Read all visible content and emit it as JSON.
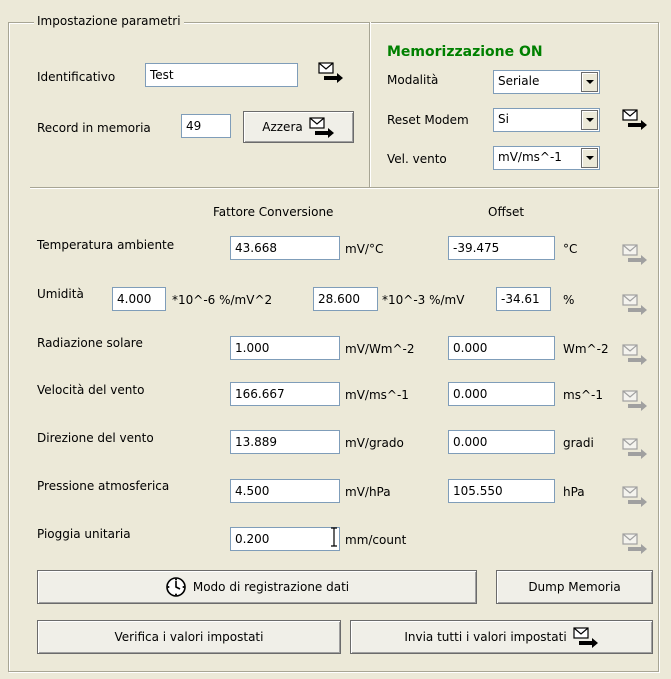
{
  "group": {
    "title": "Impostazione parametri"
  },
  "left_top": {
    "identificativo_label": "Identificativo",
    "identificativo_value": "Test",
    "record_label": "Record in memoria",
    "record_value": "49",
    "azzera_label": "Azzera"
  },
  "memorizzazione": {
    "title": "Memorizzazione ON",
    "modalita_label": "Modalità",
    "modalita_value": "Seriale",
    "reset_label": "Reset Modem",
    "reset_value": "Si",
    "vento_label": "Vel. vento",
    "vento_value": "mV/ms^-1"
  },
  "headers": {
    "fattore": "Fattore Conversione",
    "offset": "Offset"
  },
  "rows": [
    {
      "label": "Temperatura ambiente",
      "factor": "43.668",
      "factor_unit": "mV/°C",
      "offset": "-39.475",
      "offset_unit": "°C"
    },
    {
      "label": "Radiazione solare",
      "factor": "1.000",
      "factor_unit": "mV/Wm^-2",
      "offset": "0.000",
      "offset_unit": "Wm^-2"
    },
    {
      "label": "Velocità del vento",
      "factor": "166.667",
      "factor_unit": "mV/ms^-1",
      "offset": "0.000",
      "offset_unit": "ms^-1"
    },
    {
      "label": "Direzione del vento",
      "factor": "13.889",
      "factor_unit": "mV/grado",
      "offset": "0.000",
      "offset_unit": "gradi"
    },
    {
      "label": "Pressione atmosferica",
      "factor": "4.500",
      "factor_unit": "mV/hPa",
      "offset": "105.550",
      "offset_unit": "hPa"
    },
    {
      "label": "Pioggia unitaria",
      "factor": "0.200",
      "factor_unit": "mm/count"
    }
  ],
  "umidita": {
    "label": "Umidità",
    "v1": "4.000",
    "u1": "*10^-6 %/mV^2",
    "v2": "28.600",
    "u2": "*10^-3 %/mV",
    "v3": "-34.61",
    "u3": "%"
  },
  "buttons": {
    "modo": "Modo di registrazione dati",
    "dump": "Dump Memoria",
    "verifica": "Verifica i valori impostati",
    "invia": "Invia tutti i valori impostati"
  },
  "icons": {
    "send": "envelope-arrow-icon",
    "clock": "clock-icon"
  }
}
